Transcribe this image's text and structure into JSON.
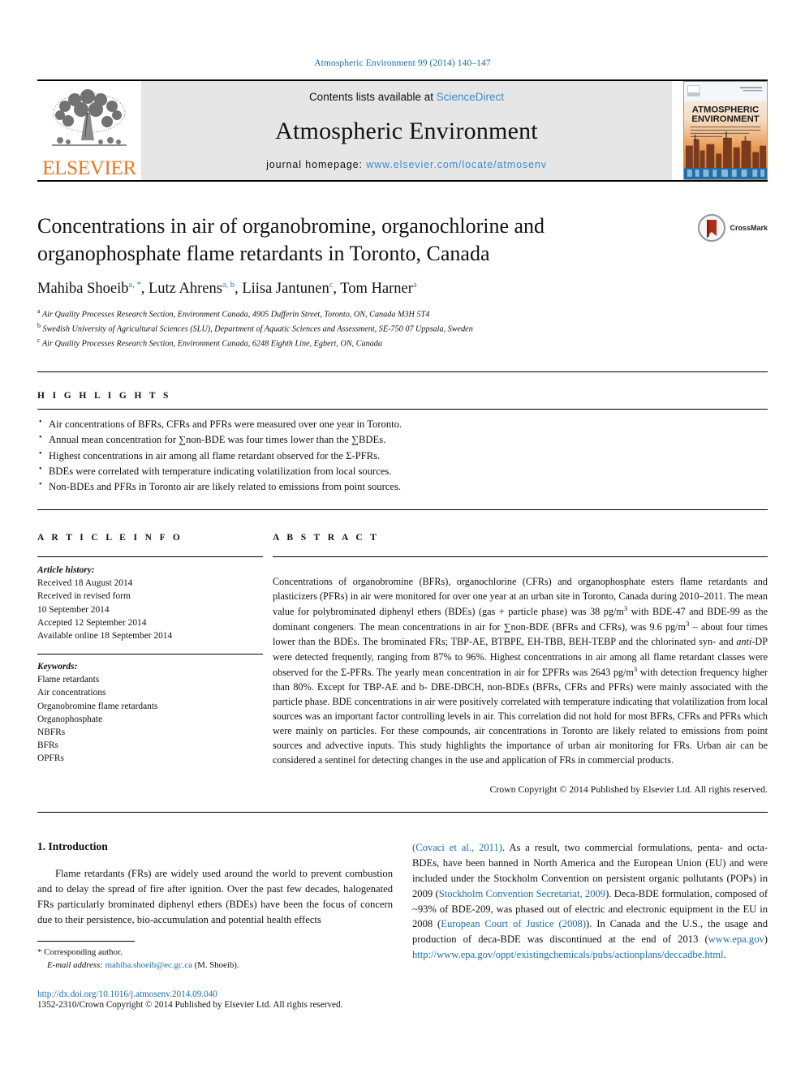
{
  "running_head": "Atmospheric Environment 99 (2014) 140–147",
  "masthead": {
    "publisher_name": "ELSEVIER",
    "contents_prefix": "Contents lists available at ",
    "contents_link": "ScienceDirect",
    "journal_title": "Atmospheric Environment",
    "homepage_prefix": "journal homepage: ",
    "homepage_url": "www.elsevier.com/locate/atmosenv",
    "cover_line1": "ATMOSPHERIC",
    "cover_line2": "ENVIRONMENT"
  },
  "article": {
    "title": "Concentrations in air of organobromine, organochlorine and organophosphate flame retardants in Toronto, Canada",
    "crossmark_label": "CrossMark",
    "authors": [
      {
        "name": "Mahiba Shoeib",
        "marks": "a, *"
      },
      {
        "name": "Lutz Ahrens",
        "marks": "a, b"
      },
      {
        "name": "Liisa Jantunen",
        "marks": "c"
      },
      {
        "name": "Tom Harner",
        "marks": "a"
      }
    ],
    "affiliations": [
      {
        "mark": "a",
        "text": "Air Quality Processes Research Section, Environment Canada, 4905 Dufferin Street, Toronto, ON, Canada M3H 5T4"
      },
      {
        "mark": "b",
        "text": "Swedish University of Agricultural Sciences (SLU), Department of Aquatic Sciences and Assessment, SE-750 07 Uppsala, Sweden"
      },
      {
        "mark": "c",
        "text": "Air Quality Processes Research Section, Environment Canada, 6248 Eighth Line, Egbert, ON, Canada"
      }
    ]
  },
  "highlights": {
    "label": "H I G H L I G H T S",
    "items": [
      "Air concentrations of BFRs, CFRs and PFRs were measured over one year in Toronto.",
      "Annual mean concentration for ∑non-BDE was four times lower than the ∑BDEs.",
      "Highest concentrations in air among all flame retardant observed for the Σ-PFRs.",
      "BDEs were correlated with temperature indicating volatilization from local sources.",
      "Non-BDEs and PFRs in Toronto air are likely related to emissions from point sources."
    ]
  },
  "article_info": {
    "label": "A R T I C L E   I N F O",
    "history_label": "Article history:",
    "history": [
      "Received 18 August 2014",
      "Received in revised form",
      "10 September 2014",
      "Accepted 12 September 2014",
      "Available online 18 September 2014"
    ],
    "keywords_label": "Keywords:",
    "keywords": [
      "Flame retardants",
      "Air concentrations",
      "Organobromine flame retardants",
      "Organophosphate",
      "NBFRs",
      "BFRs",
      "OPFRs"
    ]
  },
  "abstract": {
    "label": "A B S T R A C T",
    "text": "Concentrations of organobromine (BFRs), organochlorine (CFRs) and organophosphate esters flame retardants and plasticizers (PFRs) in air were monitored for over one year at an urban site in Toronto, Canada during 2010–2011. The mean value for polybrominated diphenyl ethers (BDEs) (gas + particle phase) was 38 pg/m3 with BDE-47 and BDE-99 as the dominant congeners. The mean concentrations in air for ∑non-BDE (BFRs and CFRs), was 9.6 pg/m3 – about four times lower than the BDEs. The brominated FRs; TBP-AE, BTBPE, EH-TBB, BEH-TEBP and the chlorinated syn- and anti-DP were detected frequently, ranging from 87% to 96%. Highest concentrations in air among all flame retardant classes were observed for the Σ-PFRs. The yearly mean concentration in air for ΣPFRs was 2643 pg/m3 with detection frequency higher than 80%. Except for TBP-AE and b- DBE-DBCH, non-BDEs (BFRs, CFRs and PFRs) were mainly associated with the particle phase. BDE concentrations in air were positively correlated with temperature indicating that volatilization from local sources was an important factor controlling levels in air. This correlation did not hold for most BFRs, CFRs and PFRs which were mainly on particles. For these compounds, air concentrations in Toronto are likely related to emissions from point sources and advective inputs. This study highlights the importance of urban air monitoring for FRs. Urban air can be considered a sentinel for detecting changes in the use and application of FRs in commercial products.",
    "copyright": "Crown Copyright © 2014 Published by Elsevier Ltd. All rights reserved."
  },
  "introduction": {
    "heading": "1. Introduction",
    "left_paragraph": "Flame retardants (FRs) are widely used around the world to prevent combustion and to delay the spread of fire after ignition. Over the past few decades, halogenated FRs particularly brominated diphenyl ethers (BDEs) have been the focus of concern due to their persistence, bio-accumulation and potential health effects",
    "right_paragraph_parts": {
      "cite1": "(Covaci et al., 2011)",
      "t1": ". As a result, two commercial formulations, penta- and octa-BDEs, have been banned in North America and the European Union (EU) and were included under the Stockholm Convention on persistent organic pollutants (POPs) in 2009 (",
      "cite2": "Stockholm Convention Secretariat, 2009",
      "t2": "). Deca-BDE formulation, composed of ~93% of BDE-209, was phased out of electric and electronic equipment in the EU in 2008 (",
      "cite3": "European Court of Justice (2008)",
      "t3": "). In Canada and the U.S., the usage and production of deca-BDE was discontinued at the end of 2013 (",
      "cite4": "www.epa.gov",
      "t4": ") ",
      "cite5": "http://www.epa.gov/oppt/existingchemicals/pubs/actionplans/deccadbe.html",
      "t5": "."
    }
  },
  "footer": {
    "corresponding_mark": "*",
    "corresponding_label": "Corresponding author.",
    "email_label": "E-mail address:",
    "email": "mahiba.shoeib@ec.gc.ca",
    "email_suffix": "(M. Shoeib).",
    "doi": "http://dx.doi.org/10.1016/j.atmosenv.2014.09.040",
    "issn_line": "1352-2310/Crown Copyright © 2014 Published by Elsevier Ltd. All rights reserved."
  },
  "colors": {
    "link": "#1a6ca8",
    "elsevier_orange": "#E87722",
    "masthead_grey": "#e6e6e6",
    "sciencedirect_blue": "#3c8bc9"
  }
}
